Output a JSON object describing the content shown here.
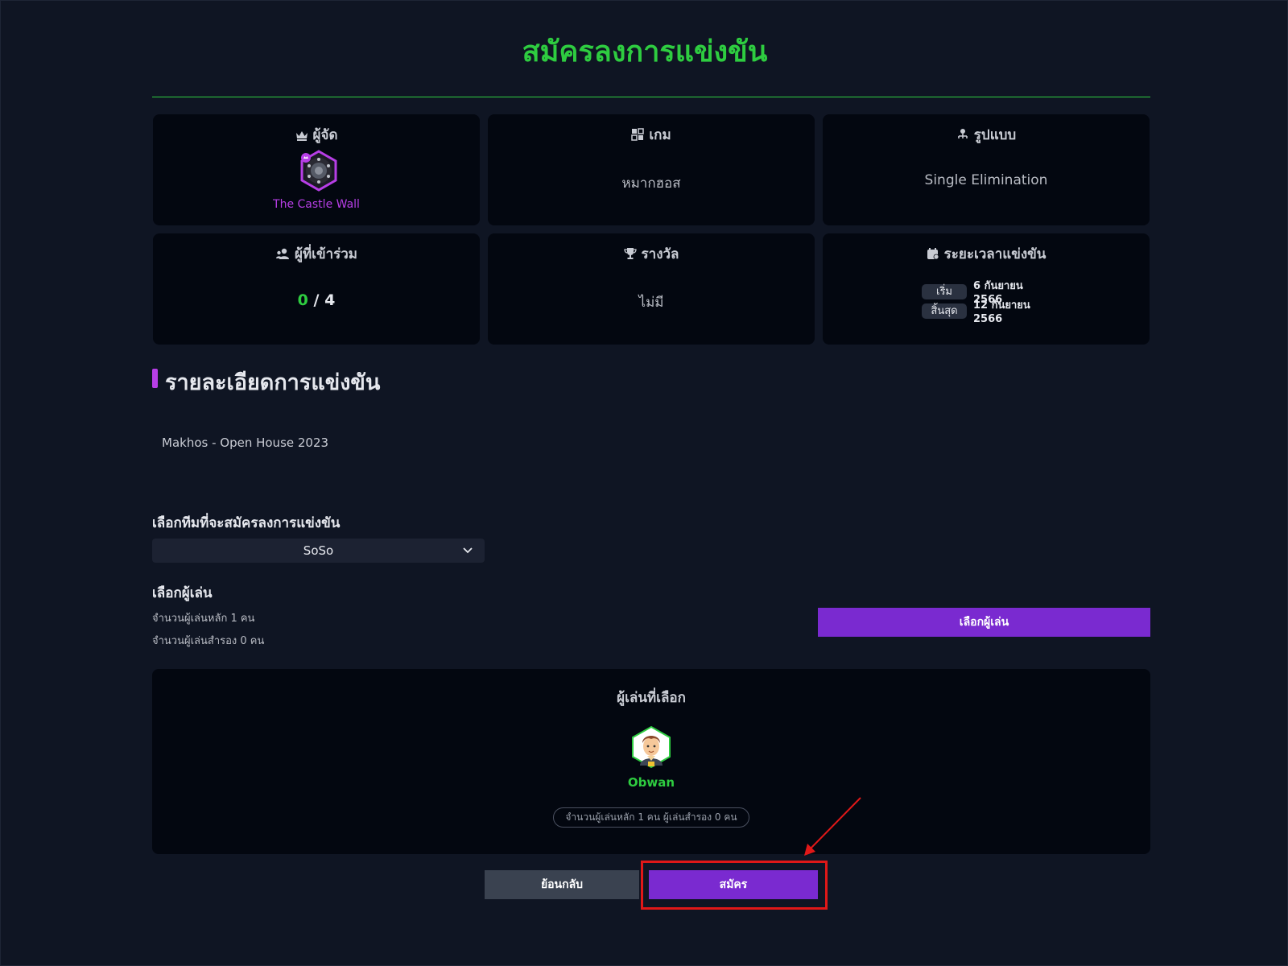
{
  "header": {
    "title": "สมัครลงการแข่งขัน"
  },
  "info_cards": {
    "organizer": {
      "label": "ผู้จัด",
      "name": "The Castle Wall"
    },
    "game": {
      "label": "เกม",
      "value": "หมากฮอส"
    },
    "format": {
      "label": "รูปแบบ",
      "value": "Single Elimination"
    },
    "participants": {
      "label": "ผู้ที่เข้าร่วม",
      "current": "0",
      "separator": " / ",
      "max": "4"
    },
    "prize": {
      "label": "รางวัล",
      "value": "ไม่มี"
    },
    "period": {
      "label": "ระยะเวลาแข่งขัน",
      "start_label": "เริ่ม",
      "start_date": "6 กันยายน 2566",
      "end_label": "สิ้นสุด",
      "end_date": "12 กันยายน 2566"
    }
  },
  "details": {
    "title": "รายละเอียดการแข่งขัน",
    "description": "Makhos - Open House 2023"
  },
  "team_select": {
    "label": "เลือกทีมที่จะสมัครลงการแข่งขัน",
    "selected": "SoSo"
  },
  "players": {
    "label": "เลือกผู้เล่น",
    "main_count": "จำนวนผู้เล่นหลัก 1 คน",
    "sub_count": "จำนวนผู้เล่นสำรอง 0 คน",
    "choose_button": "เลือกผู้เล่น"
  },
  "selected_players": {
    "title": "ผู้เล่นที่เลือก",
    "player_name": "Obwan",
    "summary": "จำนวนผู้เล่นหลัก 1 คน ผู้เล่นสำรอง 0 คน"
  },
  "actions": {
    "back_label": "ย้อนกลับ",
    "submit_label": "สมัคร"
  },
  "colors": {
    "accent_green": "#2ecc40",
    "accent_purple": "#7a2ad0",
    "organizer_purple": "#b73ee6",
    "background": "#0f1523",
    "card": "#030710",
    "highlight_red": "#e01818"
  }
}
